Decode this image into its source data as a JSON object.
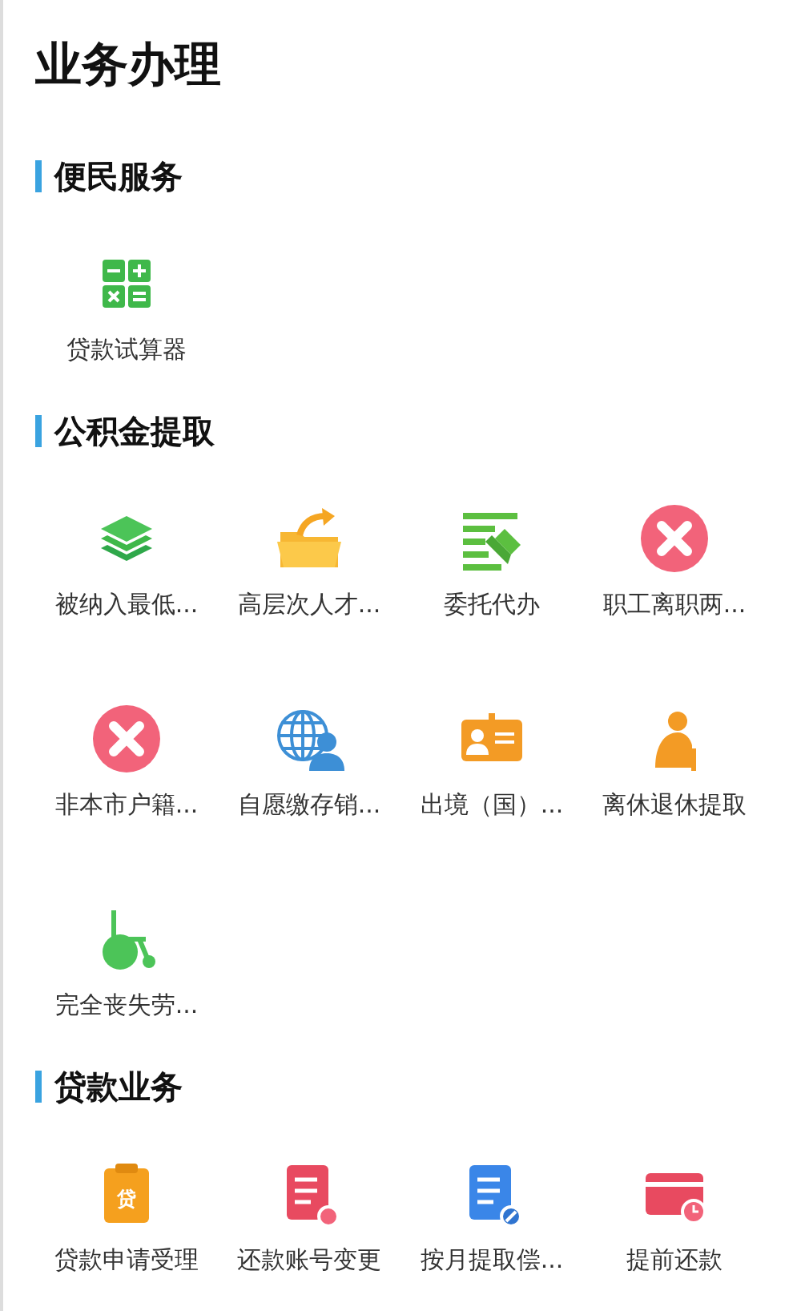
{
  "title": "业务办理",
  "sections": [
    {
      "title": "便民服务",
      "items": [
        {
          "label": "贷款试算器",
          "kind": "calculator"
        }
      ]
    },
    {
      "title": "公积金提取",
      "items": [
        {
          "label": "被纳入最低...",
          "kind": "layers"
        },
        {
          "label": "高层次人才...",
          "kind": "folder"
        },
        {
          "label": "委托代办",
          "kind": "delegate"
        },
        {
          "label": "职工离职两...",
          "kind": "cross"
        },
        {
          "label": "非本市户籍...",
          "kind": "cross"
        },
        {
          "label": "自愿缴存销...",
          "kind": "globe"
        },
        {
          "label": "出境（国）...",
          "kind": "card"
        },
        {
          "label": "离休退休提取",
          "kind": "elder"
        },
        {
          "label": "完全丧失劳...",
          "kind": "wheelchair"
        }
      ]
    },
    {
      "title": "贷款业务",
      "items": [
        {
          "label": "贷款申请受理",
          "kind": "clipboard",
          "badge": "贷"
        },
        {
          "label": "还款账号变更",
          "kind": "docred"
        },
        {
          "label": "按月提取偿...",
          "kind": "docblue"
        },
        {
          "label": "提前还款",
          "kind": "cardclock"
        }
      ]
    }
  ]
}
